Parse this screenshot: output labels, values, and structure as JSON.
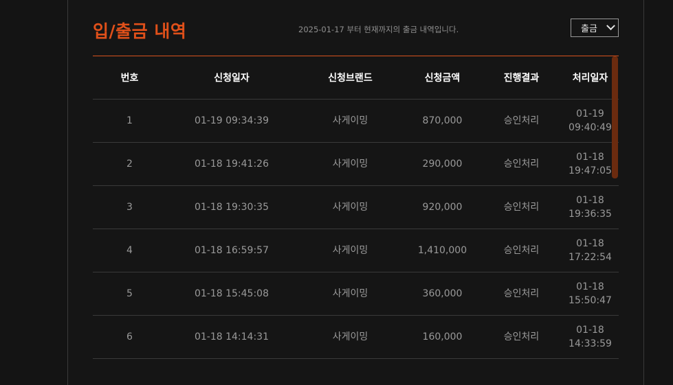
{
  "header": {
    "title": "입/출금 내역",
    "subtitle": "2025-01-17 부터 현재까지의 출금 내역입니다.",
    "select_value": "출금"
  },
  "colors": {
    "accent": "#e0501a",
    "background": "#141414",
    "scrollbar": "#6b2b0f"
  },
  "table": {
    "columns": [
      "번호",
      "신청일자",
      "신청브랜드",
      "신청금액",
      "진행결과",
      "처리일자"
    ],
    "rows": [
      {
        "no": "1",
        "date": "01-19 09:34:39",
        "brand": "사게이밍",
        "amount": "870,000",
        "status": "승인처리",
        "proc_day": "01-19",
        "proc_time": "09:40:49"
      },
      {
        "no": "2",
        "date": "01-18 19:41:26",
        "brand": "사게이밍",
        "amount": "290,000",
        "status": "승인처리",
        "proc_day": "01-18",
        "proc_time": "19:47:05"
      },
      {
        "no": "3",
        "date": "01-18 19:30:35",
        "brand": "사게이밍",
        "amount": "920,000",
        "status": "승인처리",
        "proc_day": "01-18",
        "proc_time": "19:36:35"
      },
      {
        "no": "4",
        "date": "01-18 16:59:57",
        "brand": "사게이밍",
        "amount": "1,410,000",
        "status": "승인처리",
        "proc_day": "01-18",
        "proc_time": "17:22:54"
      },
      {
        "no": "5",
        "date": "01-18 15:45:08",
        "brand": "사게이밍",
        "amount": "360,000",
        "status": "승인처리",
        "proc_day": "01-18",
        "proc_time": "15:50:47"
      },
      {
        "no": "6",
        "date": "01-18 14:14:31",
        "brand": "사게이밍",
        "amount": "160,000",
        "status": "승인처리",
        "proc_day": "01-18",
        "proc_time": "14:33:59"
      }
    ]
  }
}
